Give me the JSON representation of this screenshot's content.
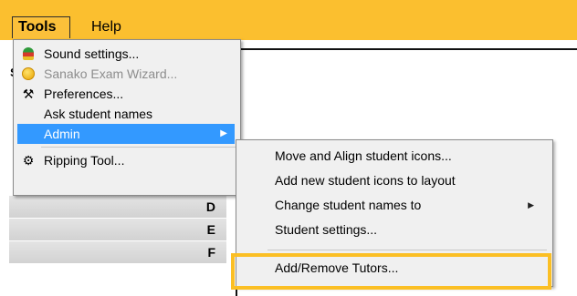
{
  "menubar": {
    "tools": "Tools",
    "help": "Help"
  },
  "background": {
    "s_letter": "S",
    "rows": [
      "D",
      "E",
      "F"
    ]
  },
  "tools_menu": {
    "items": [
      {
        "label": "Sound settings...",
        "icon": "speaker-settings-icon",
        "disabled": false
      },
      {
        "label": "Sanako Exam Wizard...",
        "icon": "exam-wizard-icon",
        "disabled": true
      },
      {
        "label": "Preferences...",
        "icon": "tools-icon",
        "disabled": false
      },
      {
        "label": "Ask student names",
        "icon": "",
        "disabled": false
      },
      {
        "label": "Admin",
        "icon": "",
        "disabled": false,
        "active": true,
        "submenu": true
      },
      {
        "label": "Ripping Tool...",
        "icon": "ripping-tool-icon",
        "disabled": false
      }
    ]
  },
  "admin_submenu": {
    "items": [
      {
        "label": "Move and Align student icons..."
      },
      {
        "label": "Add new student icons to layout"
      },
      {
        "label": "Change student names to",
        "submenu": true
      },
      {
        "label": "Student settings..."
      },
      {
        "label": "Add/Remove Tutors...",
        "highlighted": true
      }
    ]
  },
  "colors": {
    "menubar": "#fbbf2f",
    "selection": "#3399ff",
    "highlight_box": "#fbbf24"
  }
}
